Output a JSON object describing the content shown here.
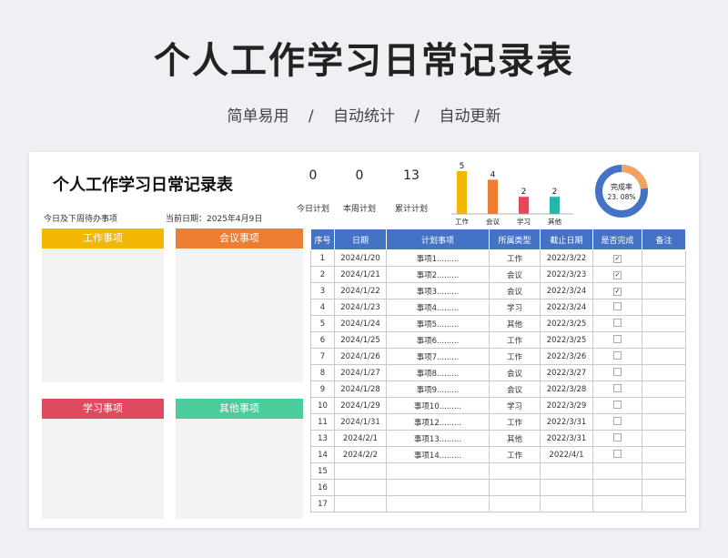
{
  "hero": {
    "title": "个人工作学习日常记录表",
    "tags": [
      "简单易用",
      "/",
      "自动统计",
      "/",
      "自动更新"
    ]
  },
  "sheet": {
    "title": "个人工作学习日常记录表",
    "stats": [
      {
        "value": "0",
        "label": "今日计划"
      },
      {
        "value": "0",
        "label": "本周计划"
      },
      {
        "value": "13",
        "label": "累计计划"
      }
    ],
    "pending_label": "今日及下周待办事项",
    "date_label": "当前日期：",
    "date_value": "2025年4月9日",
    "categories": [
      {
        "label": "工作事项",
        "color": "#f2b705"
      },
      {
        "label": "会议事项",
        "color": "#ed7d31"
      },
      {
        "label": "学习事项",
        "color": "#e04a5f"
      },
      {
        "label": "其他事项",
        "color": "#4ccb9b"
      }
    ],
    "donut": {
      "label": "完成率",
      "value_text": "23. 08%",
      "fraction": 0.2308,
      "color": "#4472c4",
      "done_color": "#f4a261"
    }
  },
  "chart_data": {
    "type": "bar",
    "categories": [
      "工作",
      "会议",
      "学习",
      "其他"
    ],
    "values": [
      5,
      4,
      2,
      2
    ],
    "colors": [
      "#f2b705",
      "#ed7d31",
      "#e04a5f",
      "#26b5a8"
    ],
    "ylim": [
      0,
      5
    ]
  },
  "table": {
    "headers": [
      "序号",
      "日期",
      "计划事项",
      "所属类型",
      "截止日期",
      "是否完成",
      "备注"
    ],
    "rows": [
      {
        "no": "1",
        "date": "2024/1/20",
        "item": "事项1.........",
        "type": "工作",
        "due": "2022/3/22",
        "done": true
      },
      {
        "no": "2",
        "date": "2024/1/21",
        "item": "事项2.........",
        "type": "会议",
        "due": "2022/3/23",
        "done": true
      },
      {
        "no": "3",
        "date": "2024/1/22",
        "item": "事项3.........",
        "type": "会议",
        "due": "2022/3/24",
        "done": true
      },
      {
        "no": "4",
        "date": "2024/1/23",
        "item": "事项4.........",
        "type": "学习",
        "due": "2022/3/24",
        "done": false
      },
      {
        "no": "5",
        "date": "2024/1/24",
        "item": "事项5.........",
        "type": "其他",
        "due": "2022/3/25",
        "done": false
      },
      {
        "no": "6",
        "date": "2024/1/25",
        "item": "事项6.........",
        "type": "工作",
        "due": "2022/3/25",
        "done": false
      },
      {
        "no": "7",
        "date": "2024/1/26",
        "item": "事项7.........",
        "type": "工作",
        "due": "2022/3/26",
        "done": false
      },
      {
        "no": "8",
        "date": "2024/1/27",
        "item": "事项8.........",
        "type": "会议",
        "due": "2022/3/27",
        "done": false
      },
      {
        "no": "9",
        "date": "2024/1/28",
        "item": "事项9.........",
        "type": "会议",
        "due": "2022/3/28",
        "done": false
      },
      {
        "no": "10",
        "date": "2024/1/29",
        "item": "事项10.........",
        "type": "学习",
        "due": "2022/3/29",
        "done": false
      },
      {
        "no": "11",
        "date": "2024/1/31",
        "item": "事项12.........",
        "type": "工作",
        "due": "2022/3/31",
        "done": false
      },
      {
        "no": "13",
        "date": "2024/2/1",
        "item": "事项13.........",
        "type": "其他",
        "due": "2022/3/31",
        "done": false
      },
      {
        "no": "14",
        "date": "2024/2/2",
        "item": "事项14.........",
        "type": "工作",
        "due": "2022/4/1",
        "done": false
      },
      {
        "no": "15",
        "date": "",
        "item": "",
        "type": "",
        "due": "",
        "done": null
      },
      {
        "no": "16",
        "date": "",
        "item": "",
        "type": "",
        "due": "",
        "done": null
      },
      {
        "no": "17",
        "date": "",
        "item": "",
        "type": "",
        "due": "",
        "done": null
      }
    ]
  }
}
